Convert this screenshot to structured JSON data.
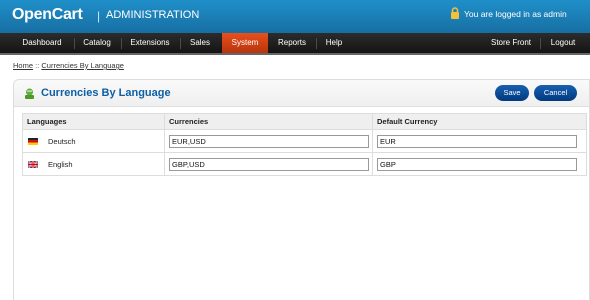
{
  "header": {
    "logo": "OpenCart",
    "separator": "|",
    "admin_label": "ADMINISTRATION",
    "logged_in_text": "You are logged in as admin",
    "lock_icon": "lock-icon"
  },
  "menu": {
    "items": [
      "Dashboard",
      "Catalog",
      "Extensions",
      "Sales",
      "System",
      "Reports",
      "Help"
    ],
    "active": "System",
    "right": [
      "Store Front",
      "Logout"
    ]
  },
  "breadcrumb": {
    "home": "Home",
    "separator": "::",
    "current": "Currencies By Language"
  },
  "page": {
    "title": "Currencies By Language",
    "icon": "currency-icon",
    "save_label": "Save",
    "cancel_label": "Cancel"
  },
  "table": {
    "headers": [
      "Languages",
      "Currencies",
      "Default Currency"
    ],
    "rows": [
      {
        "language": "Deutsch",
        "flag": "de-flag-icon",
        "currencies": "EUR,USD",
        "default": "EUR"
      },
      {
        "language": "English",
        "flag": "gb-flag-icon",
        "currencies": "GBP,USD",
        "default": "GBP"
      }
    ]
  },
  "colors": {
    "header_blue": "#1f8fc9",
    "menu_active": "#e8501c",
    "title_blue": "#0d5fa6",
    "button_blue": "#1a5fb0"
  }
}
